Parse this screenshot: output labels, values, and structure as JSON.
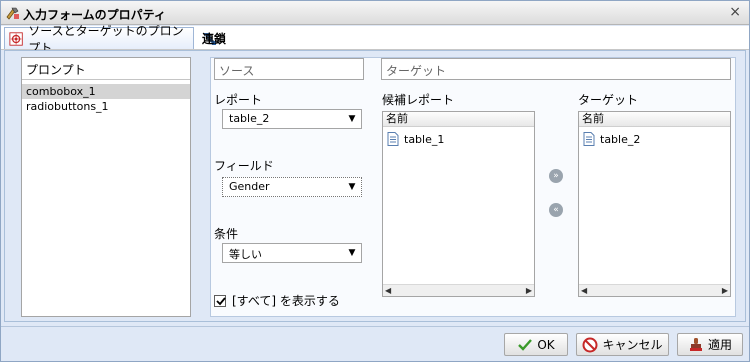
{
  "window": {
    "title": "入力フォームのプロパティ",
    "close_glyph": "×"
  },
  "tabs": [
    {
      "label": "ソースとターゲットのプロンプト",
      "active": true,
      "icon": "prompt-target-icon"
    },
    {
      "label": "連鎖",
      "active": false,
      "icon": "chain-icon"
    }
  ],
  "prompts_panel": {
    "header": "プロンプト",
    "items": [
      "combobox_1",
      "radiobuttons_1"
    ],
    "selected": "combobox_1"
  },
  "source": {
    "header": "ソース",
    "report_label": "レポート",
    "report_value": "table_2",
    "field_label": "フィールド",
    "field_value": "Gender",
    "condition_label": "条件",
    "condition_value": "等しい",
    "show_all_label": "[すべて] を表示する",
    "show_all_checked": true
  },
  "target": {
    "header": "ターゲット",
    "candidate_label": "候補レポート",
    "target_label": "ターゲット",
    "column_header": "名前",
    "candidate_items": [
      "table_1"
    ],
    "target_items": [
      "table_2"
    ],
    "move_right_glyph": "»",
    "move_left_glyph": "«"
  },
  "footer": {
    "ok_label": "OK",
    "cancel_label": "キャンセル",
    "apply_label": "適用"
  },
  "colors": {
    "accent_blue": "#dfe8f6",
    "ok_check": "#3a9a2a",
    "cancel_red": "#c62828"
  }
}
